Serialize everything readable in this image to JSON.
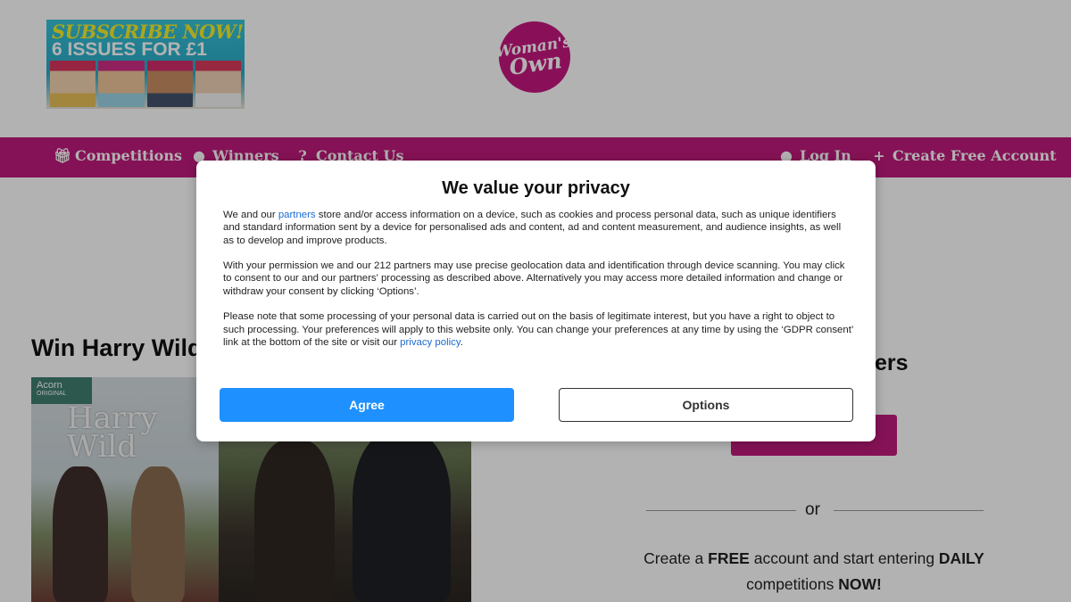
{
  "header": {
    "promo": {
      "line1": "SUBSCRIBE NOW!",
      "line2": "6 ISSUES FOR £1"
    },
    "logo": {
      "line1": "Woman's",
      "line2": "Own"
    }
  },
  "nav": {
    "competitions": "Competitions",
    "winners": "Winners",
    "contact": "Contact Us",
    "login": "Log In",
    "create_account": "Create Free Account"
  },
  "article": {
    "title": "Win Harry Wild",
    "image": {
      "badge_brand": "Acorn",
      "badge_sub": "ORIGINAL",
      "show_title_line1": "Harry",
      "show_title_line2": "Wild"
    }
  },
  "sidebar": {
    "heading": "ers",
    "or": "or",
    "promo_parts": {
      "p1": "Create a ",
      "b1": "FREE",
      "p2": " account and start entering ",
      "b2": "DAILY",
      "p3": "competitions ",
      "b3": "NOW!"
    }
  },
  "consent": {
    "title": "We value your privacy",
    "p1_a": "We and our ",
    "p1_link": "partners",
    "p1_b": " store and/or access information on a device, such as cookies and process personal data, such as unique identifiers and standard information sent by a device for personalised ads and content, ad and content measurement, and audience insights, as well as to develop and improve products.",
    "p2": "With your permission we and our 212 partners may use precise geolocation data and identification through device scanning. You may click to consent to our and our partners' processing as described above. Alternatively you may access more detailed information and change or withdraw your consent by clicking ‘Options’.",
    "p3_a": "Please note that some processing of your personal data is carried out on the basis of legitimate interest, but you have a right to object to such processing. Your preferences will apply to this website only. You can change your preferences at any time by using the ‘GDPR consent’ link at the bottom of the site or visit our ",
    "p3_link": "privacy policy",
    "p3_b": ".",
    "agree": "Agree",
    "options": "Options"
  },
  "colors": {
    "brand_magenta": "#bf1b7c",
    "agree_blue": "#1e90ff",
    "link_blue": "#1a6bd0"
  },
  "icons": {
    "competitions": "gift-icon",
    "winners": "map-pin-icon",
    "contact": "question-circle-icon",
    "login": "user-icon",
    "create_account": "user-plus-icon"
  }
}
